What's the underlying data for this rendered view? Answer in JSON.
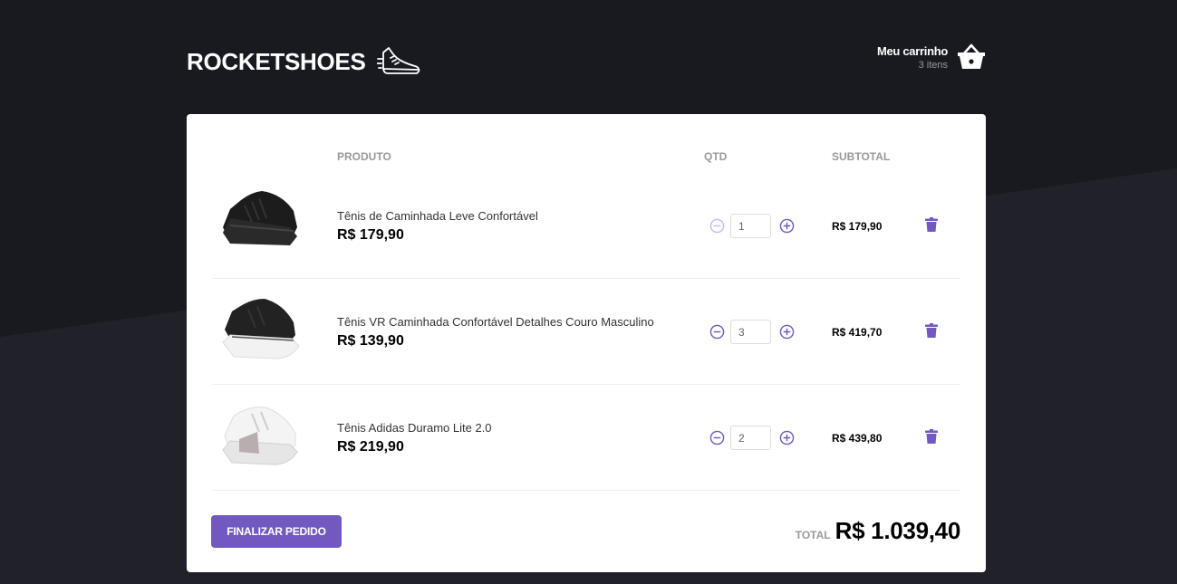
{
  "header": {
    "brand": "ROCKETSHOES",
    "logo_icon": "running-shoe-icon",
    "cart": {
      "title": "Meu carrinho",
      "count": "3 itens",
      "icon": "basket-icon"
    }
  },
  "table": {
    "columns": {
      "product": "PRODUTO",
      "qty": "QTD",
      "subtotal": "SUBTOTAL"
    },
    "rows": [
      {
        "image": "sneaker-black",
        "title": "Tênis de Caminhada Leve Confortável",
        "price": "R$ 179,90",
        "qty": "1",
        "subtotal": "R$ 179,90"
      },
      {
        "image": "sneaker-black-white-sole",
        "title": "Tênis VR Caminhada Confortável Detalhes Couro Masculino",
        "price": "R$ 139,90",
        "qty": "3",
        "subtotal": "R$ 419,70"
      },
      {
        "image": "sneaker-white",
        "title": "Tênis Adidas Duramo Lite 2.0",
        "price": "R$ 219,90",
        "qty": "2",
        "subtotal": "R$ 439,80"
      }
    ]
  },
  "footer": {
    "finish_label": "FINALIZAR PEDIDO",
    "total_label": "TOTAL",
    "total_value": "R$ 1.039,40"
  },
  "colors": {
    "accent": "#7159c1",
    "background_dark": "#191920",
    "background_light": "#212129",
    "panel": "#ffffff"
  }
}
